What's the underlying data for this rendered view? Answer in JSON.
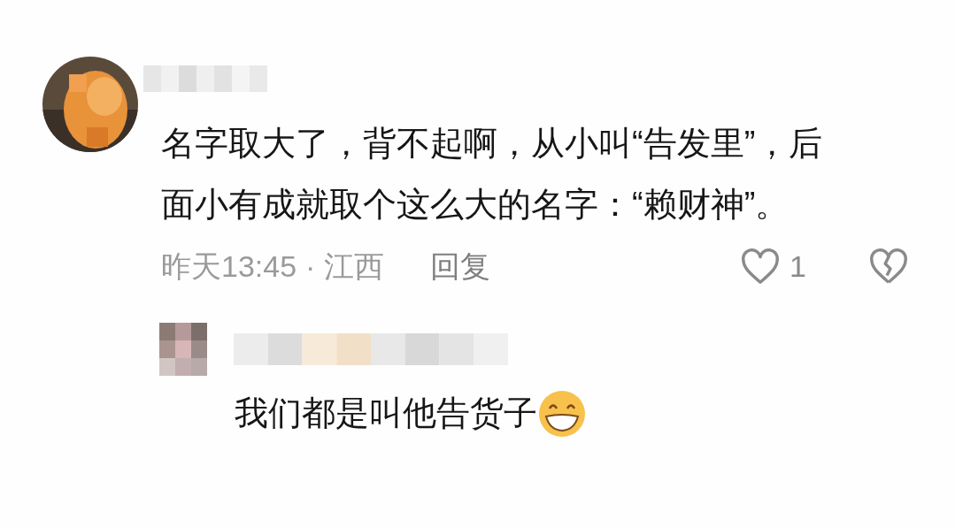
{
  "comment": {
    "text": "名字取大了，背不起啊，从小叫“告发里”，后面小有成就取个这么大的名字：“赖财神”。",
    "time": "昨天13:45",
    "separator": "·",
    "location": "江西",
    "reply_label": "回复",
    "likes": "1",
    "liked": false
  },
  "reply": {
    "text": "我们都是叫他告货子"
  }
}
